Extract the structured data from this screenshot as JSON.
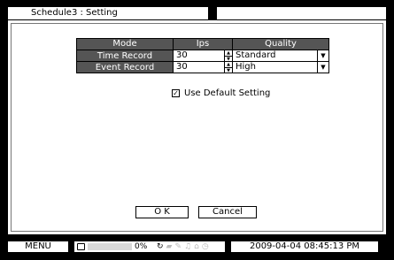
{
  "title": "Schedule3 : Setting",
  "table": {
    "headers": {
      "mode": "Mode",
      "ips": "Ips",
      "quality": "Quality"
    },
    "rows": [
      {
        "mode": "Time Record",
        "ips": "30",
        "quality": "Standard"
      },
      {
        "mode": "Event Record",
        "ips": "30",
        "quality": "High"
      }
    ]
  },
  "use_default": {
    "label": "Use Default Setting",
    "checked": true,
    "mark": "☑"
  },
  "buttons": {
    "ok": "O K",
    "cancel": "Cancel"
  },
  "statusbar": {
    "menu": "MENU",
    "disk_usage_percent": "0%",
    "disk_usage_value": 0,
    "datetime": "2009-04-04  08:45:13 PM"
  }
}
